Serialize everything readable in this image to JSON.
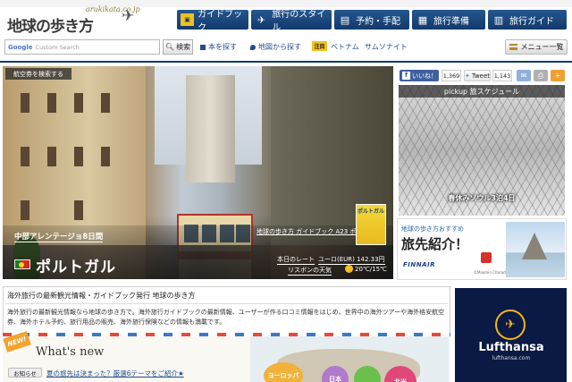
{
  "header": {
    "logo_url": "arukikata.co.jp",
    "logo_title": "地球の歩き方",
    "nav": [
      "ガイドブック",
      "旅行のスタイル",
      "予約・手配",
      "旅行準備",
      "旅行ガイド"
    ]
  },
  "search": {
    "placeholder": "Custom Search",
    "google": "Google",
    "button": "検索",
    "link_book": "本を探す",
    "link_map": "地図から探す",
    "hot_label": "注目",
    "hot_items": [
      "ベトナム",
      "サムソナイト"
    ],
    "menu": "メニュー一覧"
  },
  "hero": {
    "badge": "航空券を検索する",
    "tour_title": "中部アレンテージョ8日間",
    "country": "ポルトガル",
    "guide_link": "地球の歩き方 ガイドブック A23 ポルトガル",
    "cover_label": "ポルトガル",
    "rate_label": "本日のレート",
    "rate_value": "ユーロ(EUR) 142.33円",
    "weather_label": "リスボンの天気",
    "weather_temp": "20℃/15℃"
  },
  "social": {
    "like": "いいね！",
    "like_count": "1,369",
    "tweet": "Tweet",
    "tweet_count": "1,143"
  },
  "pickup": {
    "title": "pickup 旅スケジュール",
    "caption": "春休みソウル3泊4日"
  },
  "ad_finnair": {
    "pre": "地球の歩き方おすすめ",
    "title": "旅先紹介！",
    "brand": "FINNAIR",
    "copyright": "©Moomin Characters™"
  },
  "info": {
    "title": "海外旅行の最新観光情報・ガイドブック発行 地球の歩き方",
    "text": "海外旅行の最新観光情報なら地球の歩き方で。海外旅行ガイドブックの最新情報、ユーザーが作る口コミ情報をはじめ、世界中の海外ツアーや海外格安航空券、海外ホテル予約、旅行用品の販売、海外旅行保険などの情報も満載です。"
  },
  "news": {
    "badge": "NEW!",
    "heading": "What's new",
    "tag": "お知らせ",
    "item": "夏の旅先は決まった？厳選6テーマをご紹介★"
  },
  "map": {
    "europe": "ヨーロッパ",
    "japan": "日本",
    "america": "北米"
  },
  "lufthansa": {
    "name": "Lufthansa",
    "url": "lufthansa.com"
  }
}
